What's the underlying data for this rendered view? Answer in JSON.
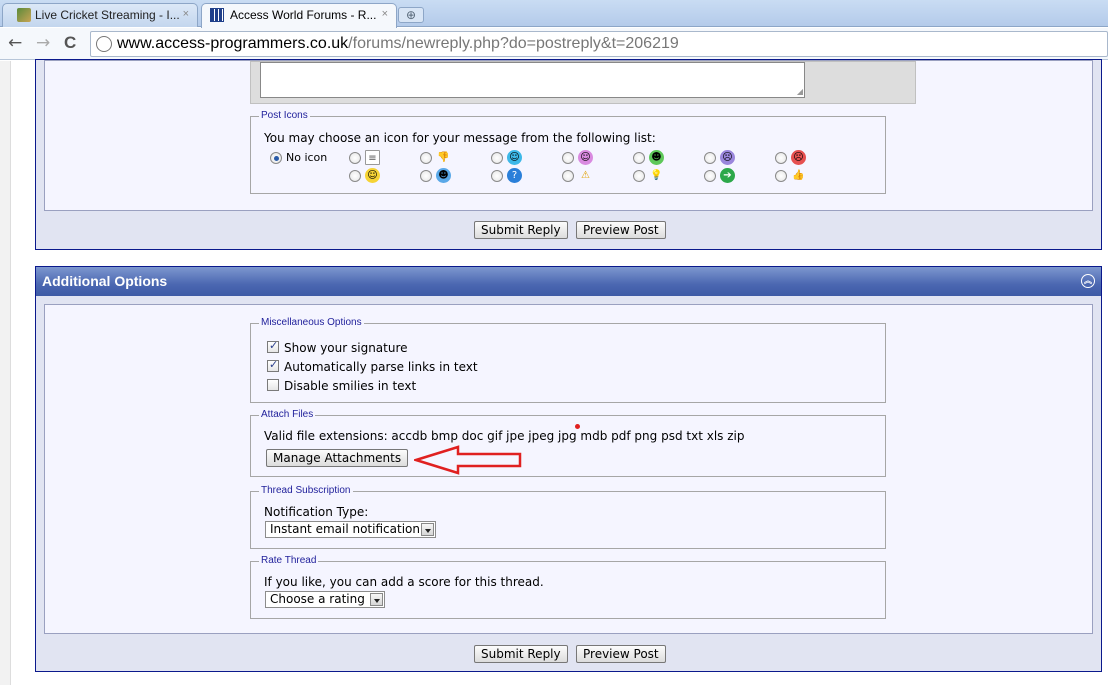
{
  "browser": {
    "tabs": [
      {
        "label": "Live Cricket Streaming - I...",
        "close": "×"
      },
      {
        "label": "Access World Forums - R...",
        "close": "×"
      }
    ],
    "new_tab": "⊕",
    "nav": {
      "back": "←",
      "forward": "→",
      "reload": "C"
    },
    "url_host": "www.access-programmers.co.uk",
    "url_path": "/forums/newreply.php?do=postreply&t=206219"
  },
  "post_icons": {
    "legend": "Post Icons",
    "prompt": "You may choose an icon for your message from the following list:",
    "no_icon_label": "No icon",
    "icon_names_row1": [
      "document-icon",
      "thumbs-down-icon",
      "smile-icon",
      "tongue-icon",
      "grin-icon",
      "frown-icon",
      "angry-icon"
    ],
    "icon_names_row2": [
      "happy-icon",
      "cool-icon",
      "question-icon",
      "warning-icon",
      "lightbulb-icon",
      "arrow-icon",
      "thumbs-up-icon"
    ]
  },
  "buttons": {
    "submit": "Submit Reply",
    "preview": "Preview Post"
  },
  "additional_options": {
    "title": "Additional Options",
    "misc": {
      "legend": "Miscellaneous Options",
      "options": [
        {
          "label": "Show your signature",
          "checked": true
        },
        {
          "label": "Automatically parse links in text",
          "checked": true
        },
        {
          "label": "Disable smilies in text",
          "checked": false
        }
      ]
    },
    "attach": {
      "legend": "Attach Files",
      "extensions": "Valid file extensions: accdb bmp doc gif jpe jpeg jpg mdb pdf png psd txt xls zip",
      "manage_button": "Manage Attachments"
    },
    "subscription": {
      "legend": "Thread Subscription",
      "label": "Notification Type:",
      "selected": "Instant email notification"
    },
    "rate": {
      "legend": "Rate Thread",
      "label": "If you like, you can add a score for this thread.",
      "selected": "Choose a rating"
    }
  },
  "colors": {
    "header": "#4b67b1",
    "annotation": "#e02020"
  }
}
